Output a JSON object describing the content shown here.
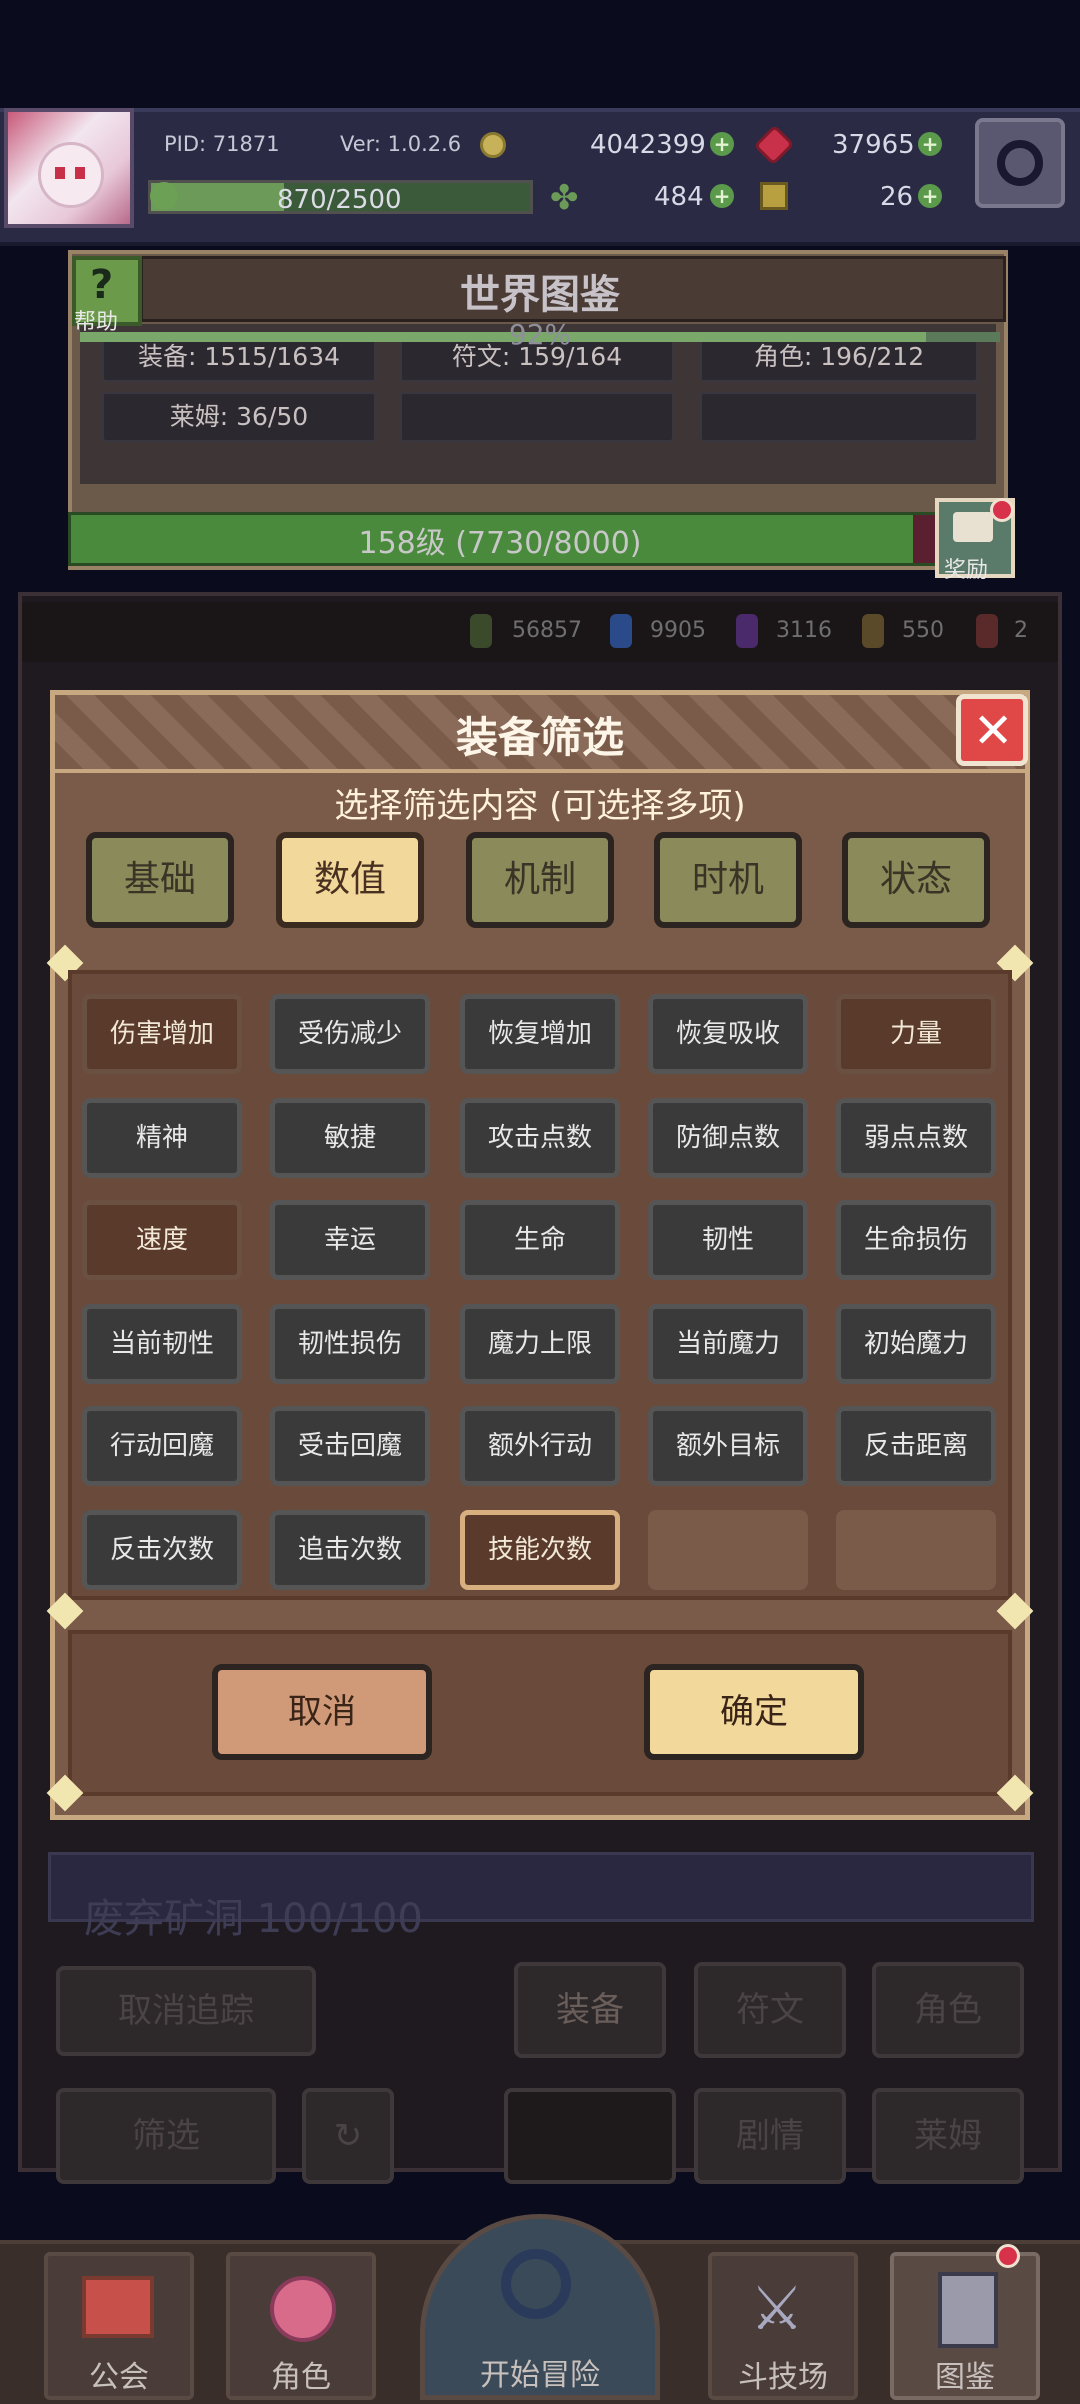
{
  "header": {
    "pid": "PID: 71871",
    "version": "Ver: 1.0.2.6",
    "gold": "4042399",
    "ruby": "37965",
    "xp": "870/2500",
    "clover": "484",
    "tickets": "26"
  },
  "codex": {
    "help": "帮助",
    "title": "世界图鉴",
    "percent": "92%",
    "stats": [
      "装备: 1515/1634",
      "符文: 159/164",
      "角色: 196/212",
      "莱姆: 36/50"
    ],
    "level": "158级 (7730/8000)",
    "reward": "奖励"
  },
  "gems": [
    "56857",
    "9905",
    "3116",
    "550",
    "2"
  ],
  "background": {
    "mine": "废弃矿洞  100/100",
    "untrack": "取消追踪",
    "filter": "筛选",
    "tabs": [
      "装备",
      "符文",
      "角色",
      "剧情",
      "莱姆"
    ]
  },
  "modal": {
    "title": "装备筛选",
    "subtitle": "选择筛选内容 (可选择多项)",
    "categories": [
      "基础",
      "数值",
      "机制",
      "时机",
      "状态"
    ],
    "active_category": "数值",
    "options": [
      "伤害增加",
      "受伤减少",
      "恢复增加",
      "恢复吸收",
      "力量",
      "精神",
      "敏捷",
      "攻击点数",
      "防御点数",
      "弱点点数",
      "速度",
      "幸运",
      "生命",
      "韧性",
      "生命损伤",
      "当前韧性",
      "韧性损伤",
      "魔力上限",
      "当前魔力",
      "初始魔力",
      "行动回魔",
      "受击回魔",
      "额外行动",
      "额外目标",
      "反击距离",
      "反击次数",
      "追击次数",
      "技能次数"
    ],
    "selected": [
      "伤害增加",
      "力量",
      "速度",
      "技能次数"
    ],
    "cancel": "取消",
    "confirm": "确定"
  },
  "nav": [
    "公会",
    "角色",
    "开始冒险",
    "斗技场",
    "图鉴"
  ]
}
